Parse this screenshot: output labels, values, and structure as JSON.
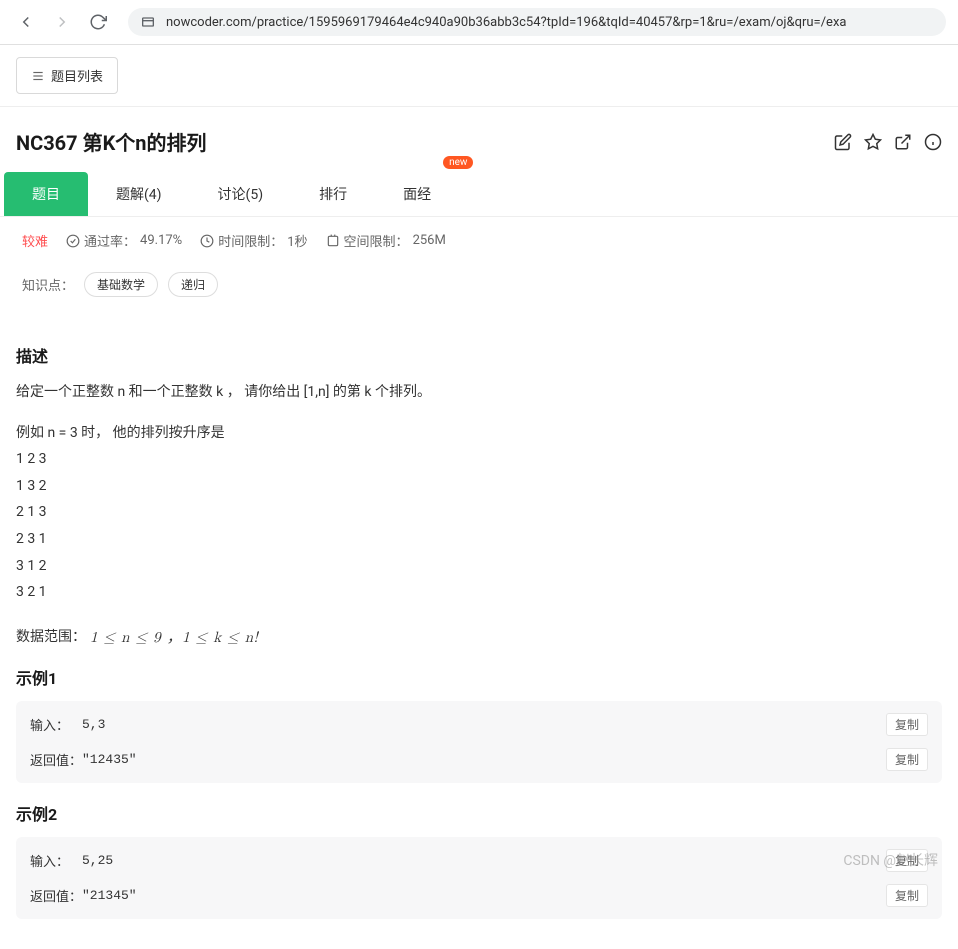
{
  "browser": {
    "url": "nowcoder.com/practice/1595969179464e4c940a90b36abb3c54?tpId=196&tqId=40457&rp=1&ru=/exam/oj&qru=/exa"
  },
  "toolbar": {
    "list_label": "题目列表"
  },
  "page": {
    "title": "NC367  第K个n的排列"
  },
  "tabs": {
    "items": [
      {
        "label": "题目"
      },
      {
        "label": "题解(4)"
      },
      {
        "label": "讨论(5)"
      },
      {
        "label": "排行"
      },
      {
        "label": "面经"
      }
    ],
    "new_badge": "new"
  },
  "meta": {
    "difficulty": "较难",
    "pass_label": "通过率：",
    "pass_value": "49.17%",
    "time_label": "时间限制：",
    "time_value": "1秒",
    "space_label": "空间限制：",
    "space_value": "256M"
  },
  "tags": {
    "label": "知识点：",
    "items": [
      "基础数学",
      "递归"
    ]
  },
  "desc": {
    "heading": "描述",
    "p1": "给定一个正整数 n 和一个正整数 k ， 请你给出 [1,n] 的第 k 个排列。",
    "p2_intro": "例如 n = 3 时， 他的排列按升序是",
    "perms": [
      "1 2 3",
      "1 3 2",
      "2 1 3",
      "2 3 1",
      "3 1 2",
      "3 2 1"
    ],
    "range_label": "数据范围：",
    "range_math": " 1 ≤ n ≤ 9 ，1 ≤ k ≤ n!"
  },
  "examples": [
    {
      "title": "示例1",
      "rows": [
        {
          "label": "输入：",
          "value": "5,3",
          "copy": "复制"
        },
        {
          "label": "返回值：",
          "value": "\"12435\"",
          "copy": "复制"
        }
      ]
    },
    {
      "title": "示例2",
      "rows": [
        {
          "label": "输入：",
          "value": "5,25",
          "copy": "复制"
        },
        {
          "label": "返回值：",
          "value": "\"21345\"",
          "copy": "复制"
        }
      ]
    }
  ],
  "watermark": "CSDN @赵长辉"
}
